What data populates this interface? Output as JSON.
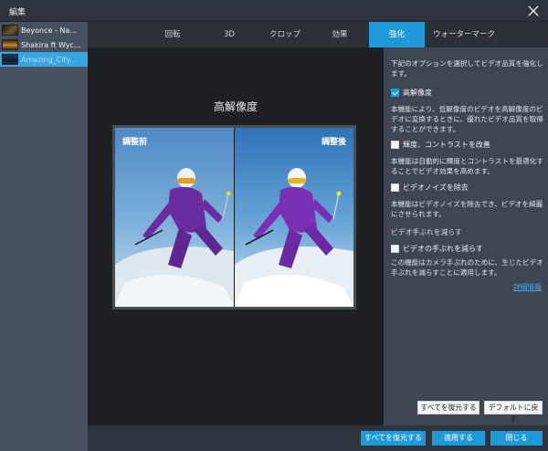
{
  "window": {
    "title": "編集"
  },
  "files": [
    {
      "name": "Beyonce - Na...",
      "selected": false
    },
    {
      "name": "Shakira ft Wyc...",
      "selected": false
    },
    {
      "name": "Amazing_City...",
      "selected": true
    }
  ],
  "tabs": [
    {
      "label": "回転",
      "active": false
    },
    {
      "label": "3D",
      "active": false
    },
    {
      "label": "クロップ",
      "active": false
    },
    {
      "label": "効果",
      "active": false
    },
    {
      "label": "強化",
      "active": true
    },
    {
      "label": "ウォーターマーク",
      "active": false
    }
  ],
  "preview": {
    "title": "高解像度",
    "before_label": "調整前",
    "after_label": "調整後"
  },
  "options": {
    "intro": "下記のオプションを選択してビデオ品質を強化します。",
    "upscale": {
      "label": "高解像度",
      "checked": true,
      "desc": "本機能により、低解像度のビデオを高解像度のビデオに変換するときに、優れたビデオ品質を取得することができます。"
    },
    "brightness": {
      "label": "輝度、コントラストを改善",
      "checked": false,
      "desc": "本機能は自動的に輝度とコントラストを最適化することでビデオ効果を高めます。"
    },
    "denoise": {
      "label": "ビデオノイズを除去",
      "checked": false,
      "desc": "本機能はビデオノイズを除去でき、ビデオを綺麗にさせられます。"
    },
    "stabilize_section": "ビデオ手ぶれを減らす",
    "stabilize": {
      "label": "ビデオの手ぶれを減らす",
      "checked": false,
      "desc": "この機能はカメラ手ぶれのために、生じたビデオ手ぶれを減らすことに適用します。"
    },
    "details_link": "詳細情報",
    "restore_all_button": "すべてを復元する",
    "defaults_button": "デフォルトに戻す"
  },
  "bottom": {
    "restore_all_button": "すべてを復元する",
    "apply_button": "適用する",
    "close_button": "閉じる"
  },
  "colors": {
    "accent": "#1f9ad9",
    "panel": "#3e4653",
    "preview_bg": "#1e2024"
  },
  "icons": {
    "close": "close-icon",
    "checkbox_checked": "checkbox-checked-icon"
  }
}
